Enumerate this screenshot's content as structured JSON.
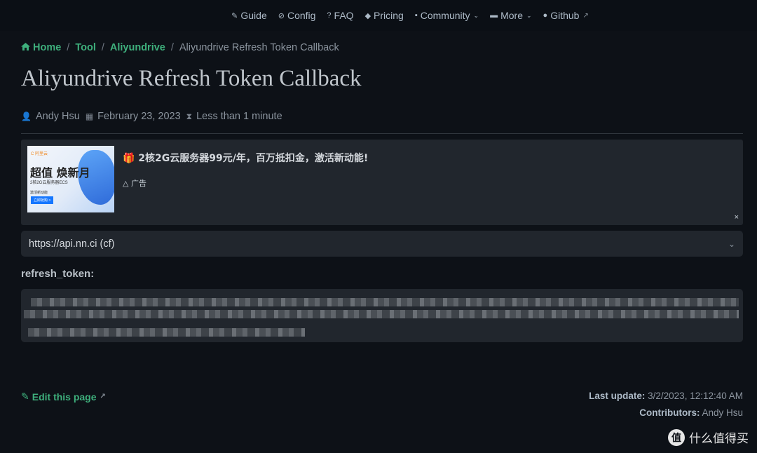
{
  "nav": {
    "items": [
      {
        "icon": "guide-icon",
        "glyph": "💡",
        "label": "Guide",
        "dropdown": false
      },
      {
        "icon": "config-icon",
        "glyph": "🧭",
        "label": "Config",
        "dropdown": false
      },
      {
        "icon": "faq-icon",
        "glyph": "❓",
        "label": "FAQ",
        "dropdown": false
      },
      {
        "icon": "pricing-icon",
        "glyph": "🏷",
        "label": "Pricing",
        "dropdown": false
      },
      {
        "icon": "community-icon",
        "glyph": "💬",
        "label": "Community",
        "dropdown": true
      },
      {
        "icon": "more-icon",
        "glyph": "▭",
        "label": "More",
        "dropdown": true
      },
      {
        "icon": "github-icon",
        "glyph": "◉",
        "label": "Github",
        "dropdown": false
      }
    ]
  },
  "breadcrumb": {
    "home": "Home",
    "sep": "/",
    "tool": "Tool",
    "aliyundrive": "Aliyundrive",
    "current": "Aliyundrive Refresh Token Callback"
  },
  "page": {
    "title": "Aliyundrive Refresh Token Callback",
    "author": "Andy Hsu",
    "date": "February 23, 2023",
    "reading_time": "Less than 1 minute"
  },
  "ad": {
    "title": "2核2G云服务器99元/年，百万抵扣金，激活新动能!",
    "label": "广告",
    "close": "×",
    "image": {
      "brand": "C 阿里云",
      "headline": "超值 焕新月",
      "line1": "2核2G云服务器ECS",
      "line2": "激活新动能",
      "cta": "立即抢购 >"
    }
  },
  "api_select": {
    "value": "https://api.nn.ci (cf)"
  },
  "form": {
    "refresh_token_label": "refresh_token:"
  },
  "footer": {
    "edit_link": "Edit this page",
    "last_update_label": "Last update:",
    "last_update_value": "3/2/2023, 12:12:40 AM",
    "contributors_label": "Contributors:",
    "contributors_value": "Andy Hsu"
  },
  "watermark": {
    "logo": "值",
    "text": "什么值得买"
  },
  "colors": {
    "background": "#0d1117",
    "accent": "#3eaf7c",
    "surface": "#21262d"
  }
}
